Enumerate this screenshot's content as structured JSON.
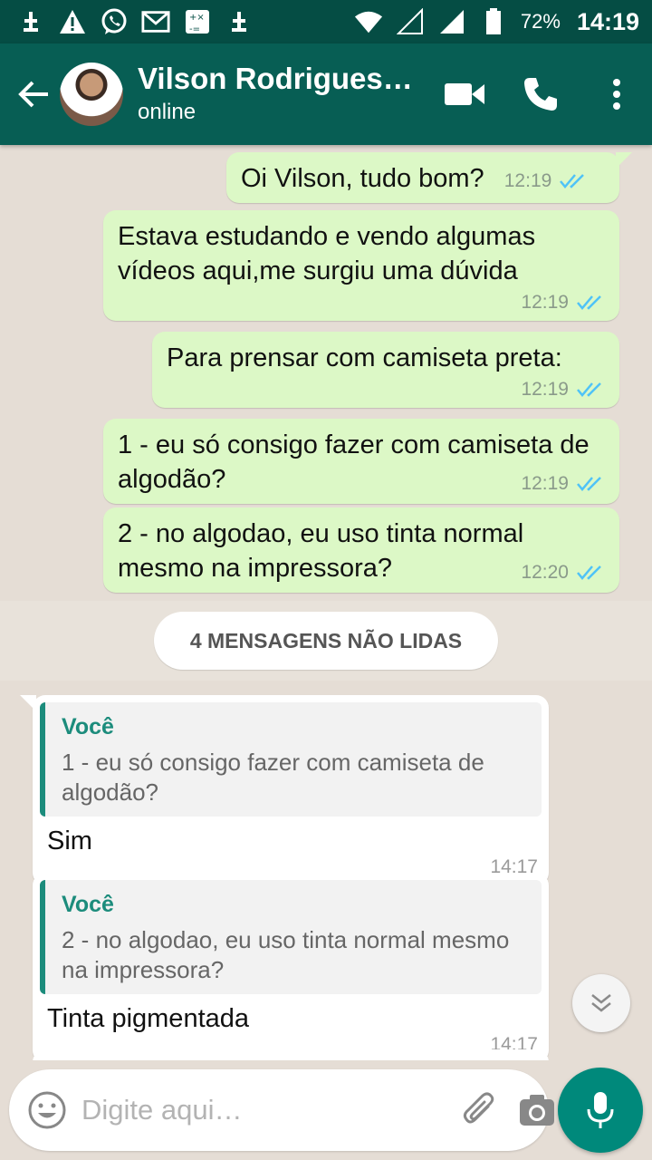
{
  "status_bar": {
    "battery": "72%",
    "time": "14:19"
  },
  "header": {
    "contact_name": "Vilson Rodrigues…",
    "contact_status": "online"
  },
  "messages_out": [
    {
      "text": "Oi Vilson, tudo bom?",
      "time": "12:19"
    },
    {
      "text": "Estava estudando e vendo algumas vídeos aqui,me surgiu uma dúvida",
      "time": "12:19"
    },
    {
      "text": "Para prensar com camiseta preta:",
      "time": "12:19"
    },
    {
      "text": "1 - eu só consigo fazer com camiseta de algodão?",
      "time": "12:19"
    },
    {
      "text": "2 - no algodao, eu uso tinta normal mesmo na impressora?",
      "time": "12:20"
    }
  ],
  "unread_label": "4 MENSAGENS NÃO LIDAS",
  "messages_in": [
    {
      "quote_author": "Você",
      "quote_text": "1 - eu só consigo fazer com camiseta de algodão?",
      "text": "Sim",
      "time": "14:17"
    },
    {
      "quote_author": "Você",
      "quote_text": "2 - no algodao, eu uso tinta normal mesmo na impressora?",
      "text": "Tinta pigmentada",
      "time": "14:17"
    }
  ],
  "input": {
    "placeholder": "Digite aqui…",
    "value": ""
  },
  "colors": {
    "status_bar": "#054d44",
    "app_bar": "#075e54",
    "bubble_out": "#dcf8c6",
    "bubble_in": "#ffffff",
    "accent": "#00897b",
    "read_ticks": "#4fc3f7"
  },
  "icons": [
    "back-arrow-icon",
    "video-call-icon",
    "phone-icon",
    "more-vert-icon",
    "emoji-icon",
    "attach-icon",
    "camera-icon",
    "mic-icon",
    "chevron-double-down-icon"
  ]
}
